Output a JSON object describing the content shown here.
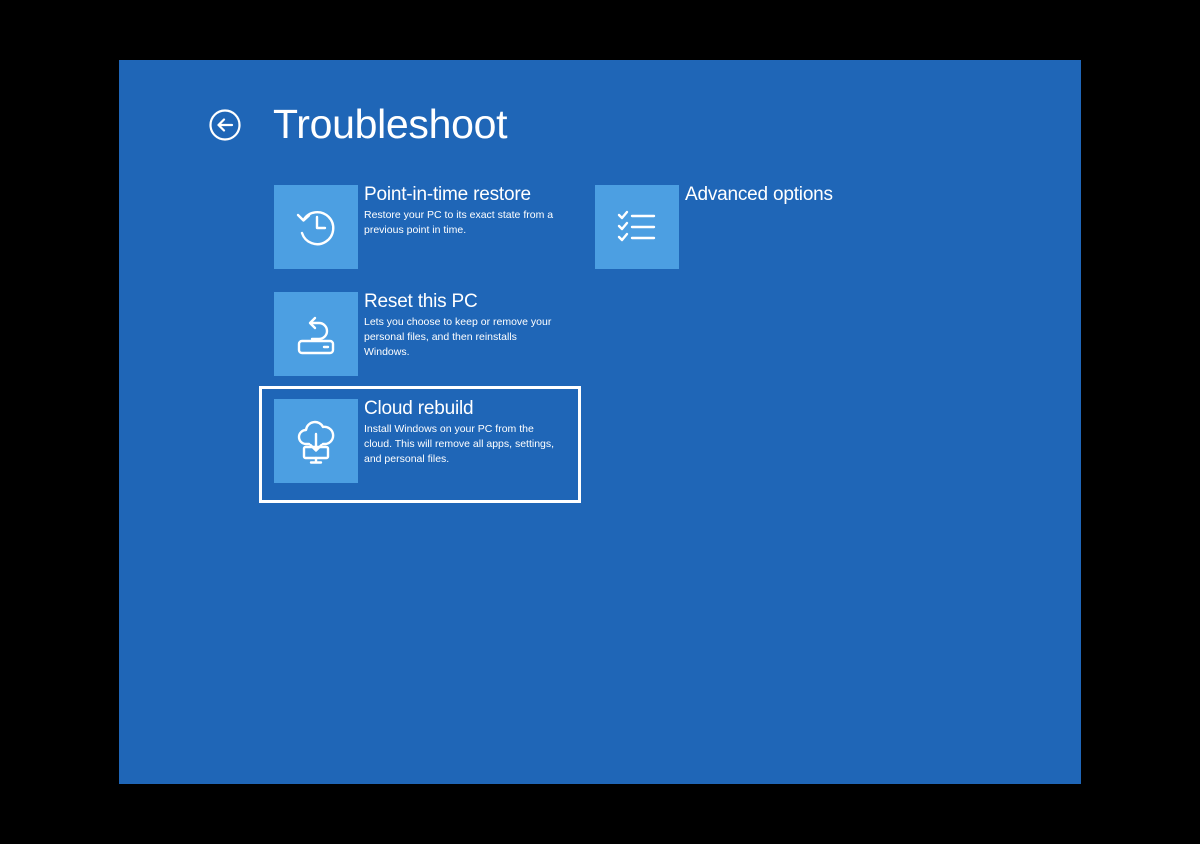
{
  "header": {
    "title": "Troubleshoot",
    "back_icon": "back-arrow-circle-icon"
  },
  "options": [
    {
      "id": "point-in-time-restore",
      "title": "Point-in-time restore",
      "description": "Restore your PC to its exact state from a previous point in time.",
      "icon": "history-clock-icon"
    },
    {
      "id": "reset-this-pc",
      "title": "Reset this PC",
      "description": "Lets you choose to keep or remove your personal files, and then reinstalls Windows.",
      "icon": "reset-pc-icon"
    },
    {
      "id": "cloud-rebuild",
      "title": "Cloud rebuild",
      "description": "Install Windows on your PC from the cloud. This will remove all apps, settings, and personal files.",
      "icon": "cloud-download-icon",
      "focused": true
    },
    {
      "id": "advanced-options",
      "title": "Advanced options",
      "description": "",
      "icon": "checklist-icon"
    }
  ],
  "colors": {
    "background": "#1f66b7",
    "tile": "#4c9fe2",
    "text": "#ffffff",
    "letterbox": "#000000"
  }
}
